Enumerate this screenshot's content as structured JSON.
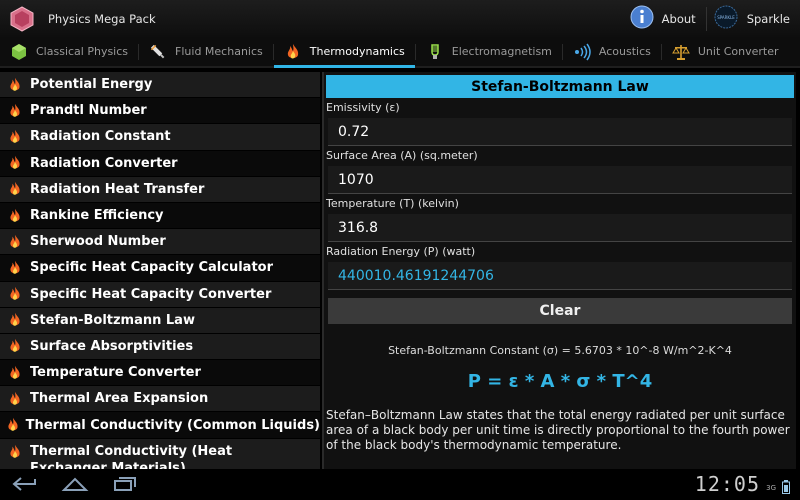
{
  "app": {
    "title": "Physics Mega Pack"
  },
  "actionbar": {
    "about_label": "About",
    "sparkle_label": "Sparkle",
    "sparkle_logo_text": "SPARKLE"
  },
  "tabs": [
    {
      "label": "Classical Physics",
      "icon": "cube-icon"
    },
    {
      "label": "Fluid Mechanics",
      "icon": "syringe-icon"
    },
    {
      "label": "Thermodynamics",
      "icon": "flame-icon"
    },
    {
      "label": "Electromagnetism",
      "icon": "bulb-icon"
    },
    {
      "label": "Acoustics",
      "icon": "sound-waves-icon"
    },
    {
      "label": "Unit Converter",
      "icon": "scale-icon"
    }
  ],
  "list": {
    "items": [
      "Potential Energy",
      "Prandtl Number",
      "Radiation Constant",
      "Radiation Converter",
      "Radiation Heat Transfer",
      "Rankine Efficiency",
      "Sherwood Number",
      "Specific Heat Capacity Calculator",
      "Specific Heat Capacity Converter",
      "Stefan-Boltzmann Law",
      "Surface Absorptivities",
      "Temperature Converter",
      "Thermal Area Expansion",
      "Thermal Conductivity (Common Liquids)",
      "Thermal Conductivity (Heat Exchanger Materials)"
    ],
    "selected_index": 9
  },
  "calculator": {
    "title": "Stefan-Boltzmann Law",
    "fields": [
      {
        "label": "Emissivity (ε)",
        "value": "0.72"
      },
      {
        "label": "Surface Area (A) (sq.meter)",
        "value": "1070"
      },
      {
        "label": "Temperature (T) (kelvin)",
        "value": "316.8"
      },
      {
        "label": "Radiation Energy (P) (watt)",
        "value": "440010.46191244706"
      }
    ],
    "clear_label": "Clear",
    "constant_text": "Stefan-Boltzmann Constant (σ) = 5.6703 * 10^-8 W/m^2-K^4",
    "formula_text": "P = ε * A * σ * T^4",
    "description": "Stefan–Boltzmann Law states that the total energy radiated per unit surface area of a black body per unit time is directly proportional to the fourth power of the black body's thermodynamic temperature."
  },
  "system": {
    "time": "12:05",
    "network": "3G"
  },
  "colors": {
    "accent": "#33b5e5",
    "title_bar": "#32b5e5",
    "flame": "#f26522"
  }
}
